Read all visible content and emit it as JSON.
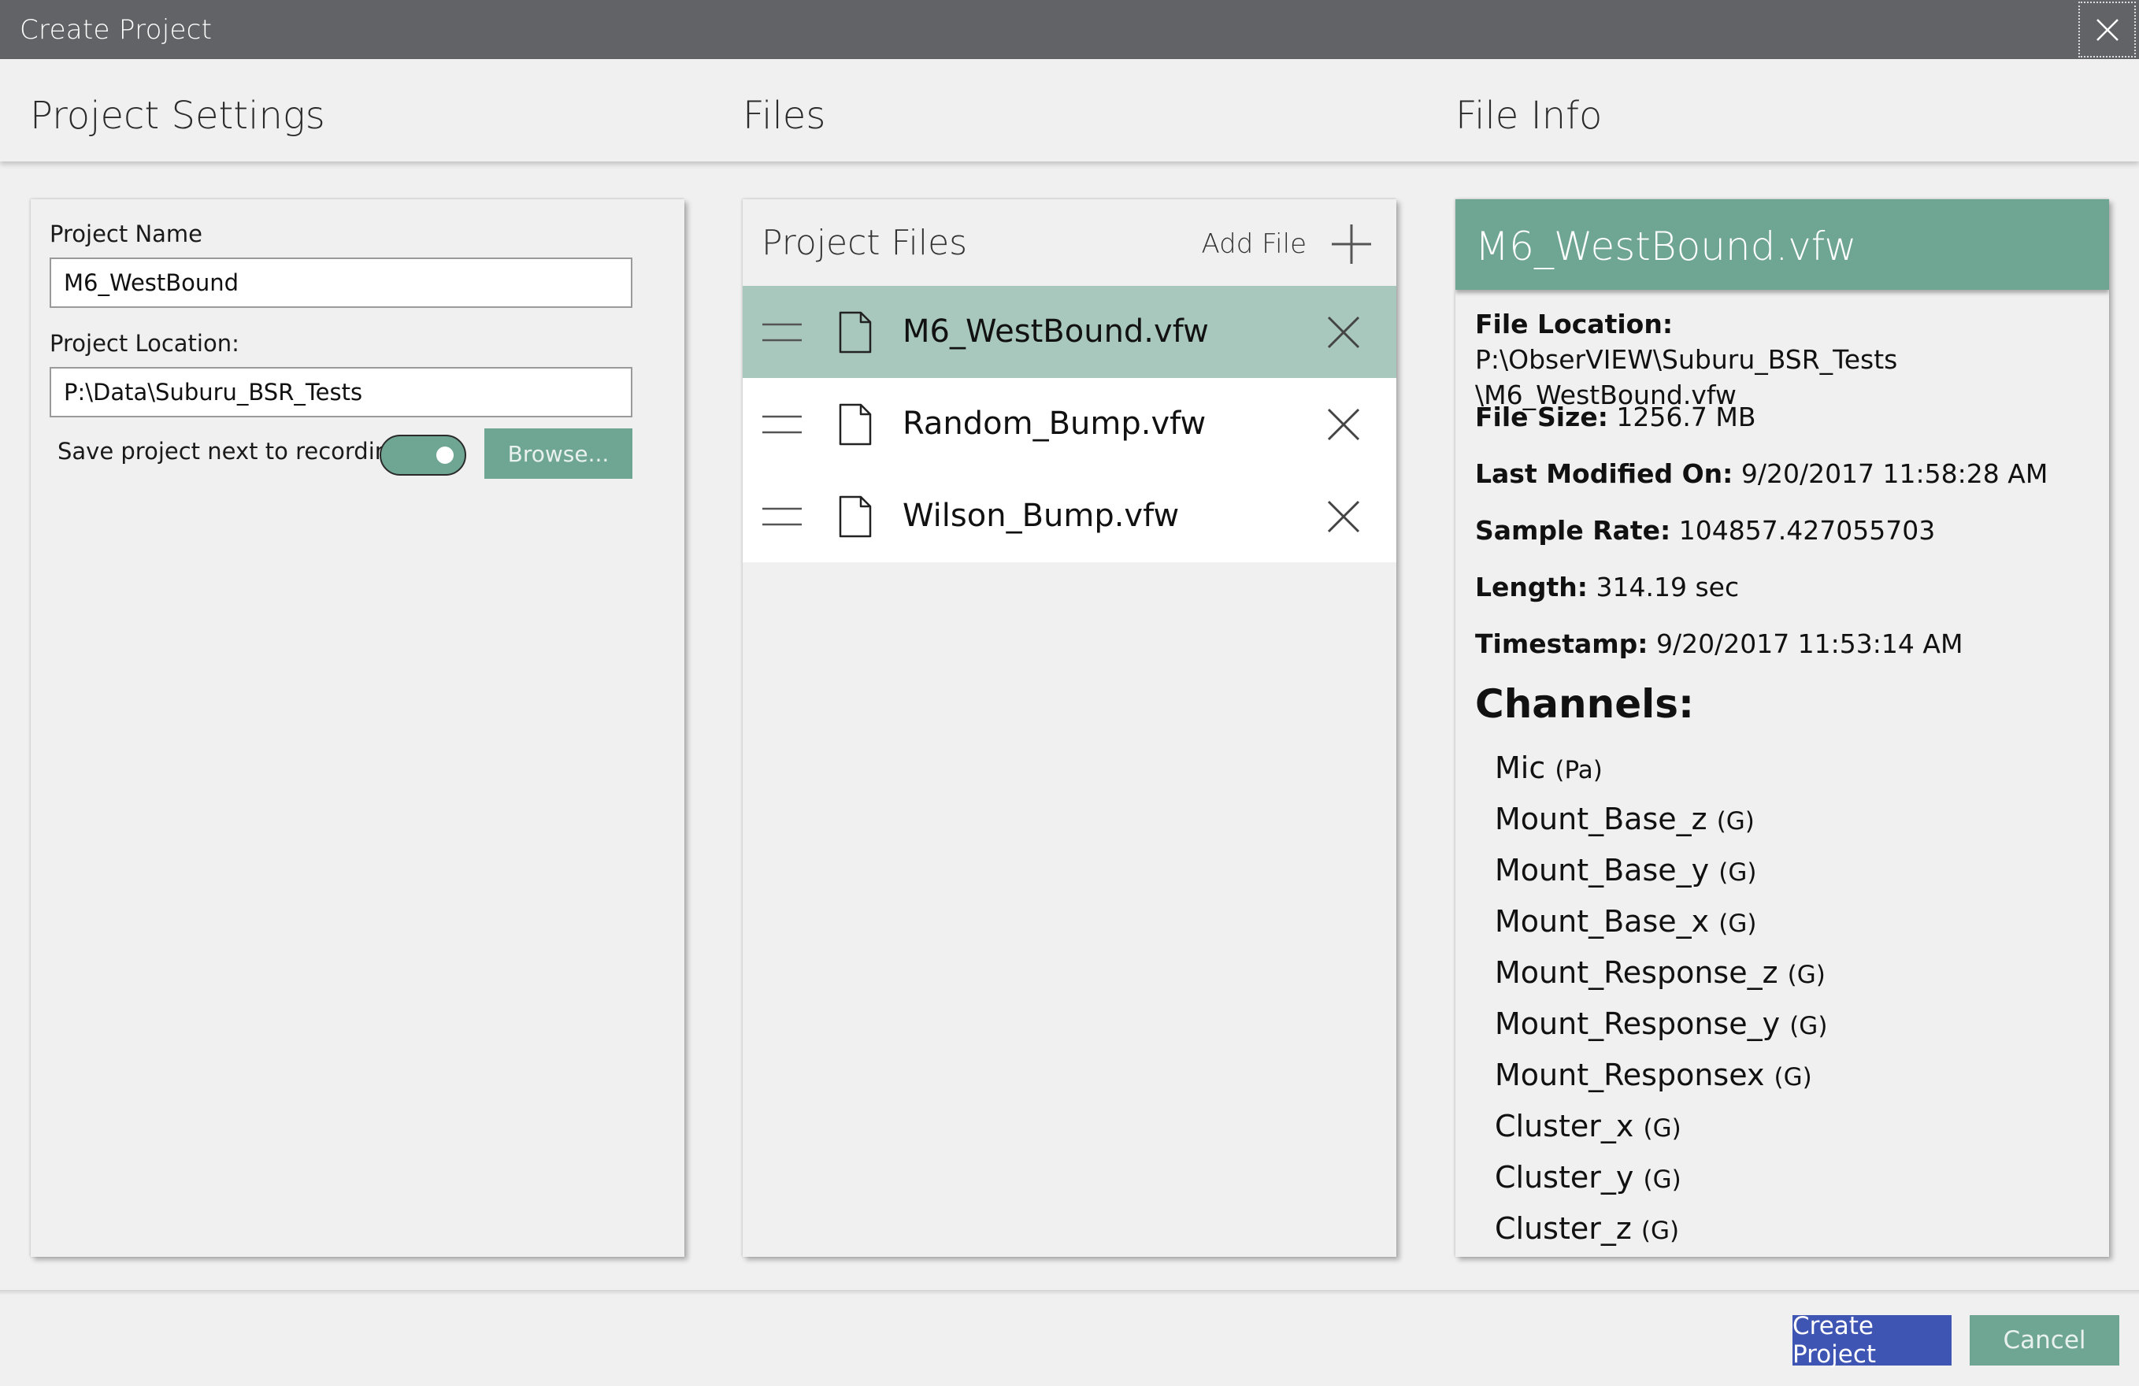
{
  "window": {
    "title": "Create Project",
    "close_icon": "close-icon"
  },
  "columns": {
    "settings": "Project Settings",
    "files": "Files",
    "info": "File Info"
  },
  "settings": {
    "project_name_label": "Project Name",
    "project_name_value": "M6_WestBound",
    "project_location_label": "Project Location:",
    "project_location_value": "P:\\Data\\Suburu_BSR_Tests",
    "save_next_label": "Save project next to recording",
    "save_next_enabled": true,
    "browse_label": "Browse..."
  },
  "files": {
    "title": "Project Files",
    "add_label": "Add File",
    "items": [
      {
        "name": "M6_WestBound.vfw",
        "selected": true
      },
      {
        "name": "Random_Bump.vfw",
        "selected": false
      },
      {
        "name": "Wilson_Bump.vfw",
        "selected": false
      }
    ]
  },
  "info": {
    "title": "M6_WestBound.vfw",
    "location_label": "File Location:",
    "location_value_line1": "P:\\ObserVIEW\\Suburu_BSR_Tests",
    "location_value_line2": "\\M6_WestBound.vfw",
    "size_label": "File Size:",
    "size_value": "1256.7 MB",
    "modified_label": "Last Modified On:",
    "modified_value": "9/20/2017 11:58:28 AM",
    "rate_label": "Sample Rate:",
    "rate_value": "104857.427055703",
    "length_label": "Length:",
    "length_value": "314.19 sec",
    "timestamp_label": "Timestamp:",
    "timestamp_value": "9/20/2017 11:53:14 AM",
    "channels_title": "Channels:",
    "channels": [
      {
        "name": "Mic",
        "unit": "(Pa)"
      },
      {
        "name": "Mount_Base_z",
        "unit": "(G)"
      },
      {
        "name": "Mount_Base_y",
        "unit": "(G)"
      },
      {
        "name": "Mount_Base_x",
        "unit": "(G)"
      },
      {
        "name": "Mount_Response_z",
        "unit": "(G)"
      },
      {
        "name": "Mount_Response_y",
        "unit": "(G)"
      },
      {
        "name": "Mount_Responsex",
        "unit": "(G)"
      },
      {
        "name": "Cluster_x",
        "unit": "(G)"
      },
      {
        "name": "Cluster_y",
        "unit": "(G)"
      },
      {
        "name": "Cluster_z",
        "unit": "(G)"
      }
    ]
  },
  "footer": {
    "create_label": "Create Project",
    "cancel_label": "Cancel"
  },
  "colors": {
    "titlebar": "#616366",
    "accent_green": "#6fa593",
    "selected_row": "#a9c8bd",
    "primary_blue": "#3f55b3"
  }
}
